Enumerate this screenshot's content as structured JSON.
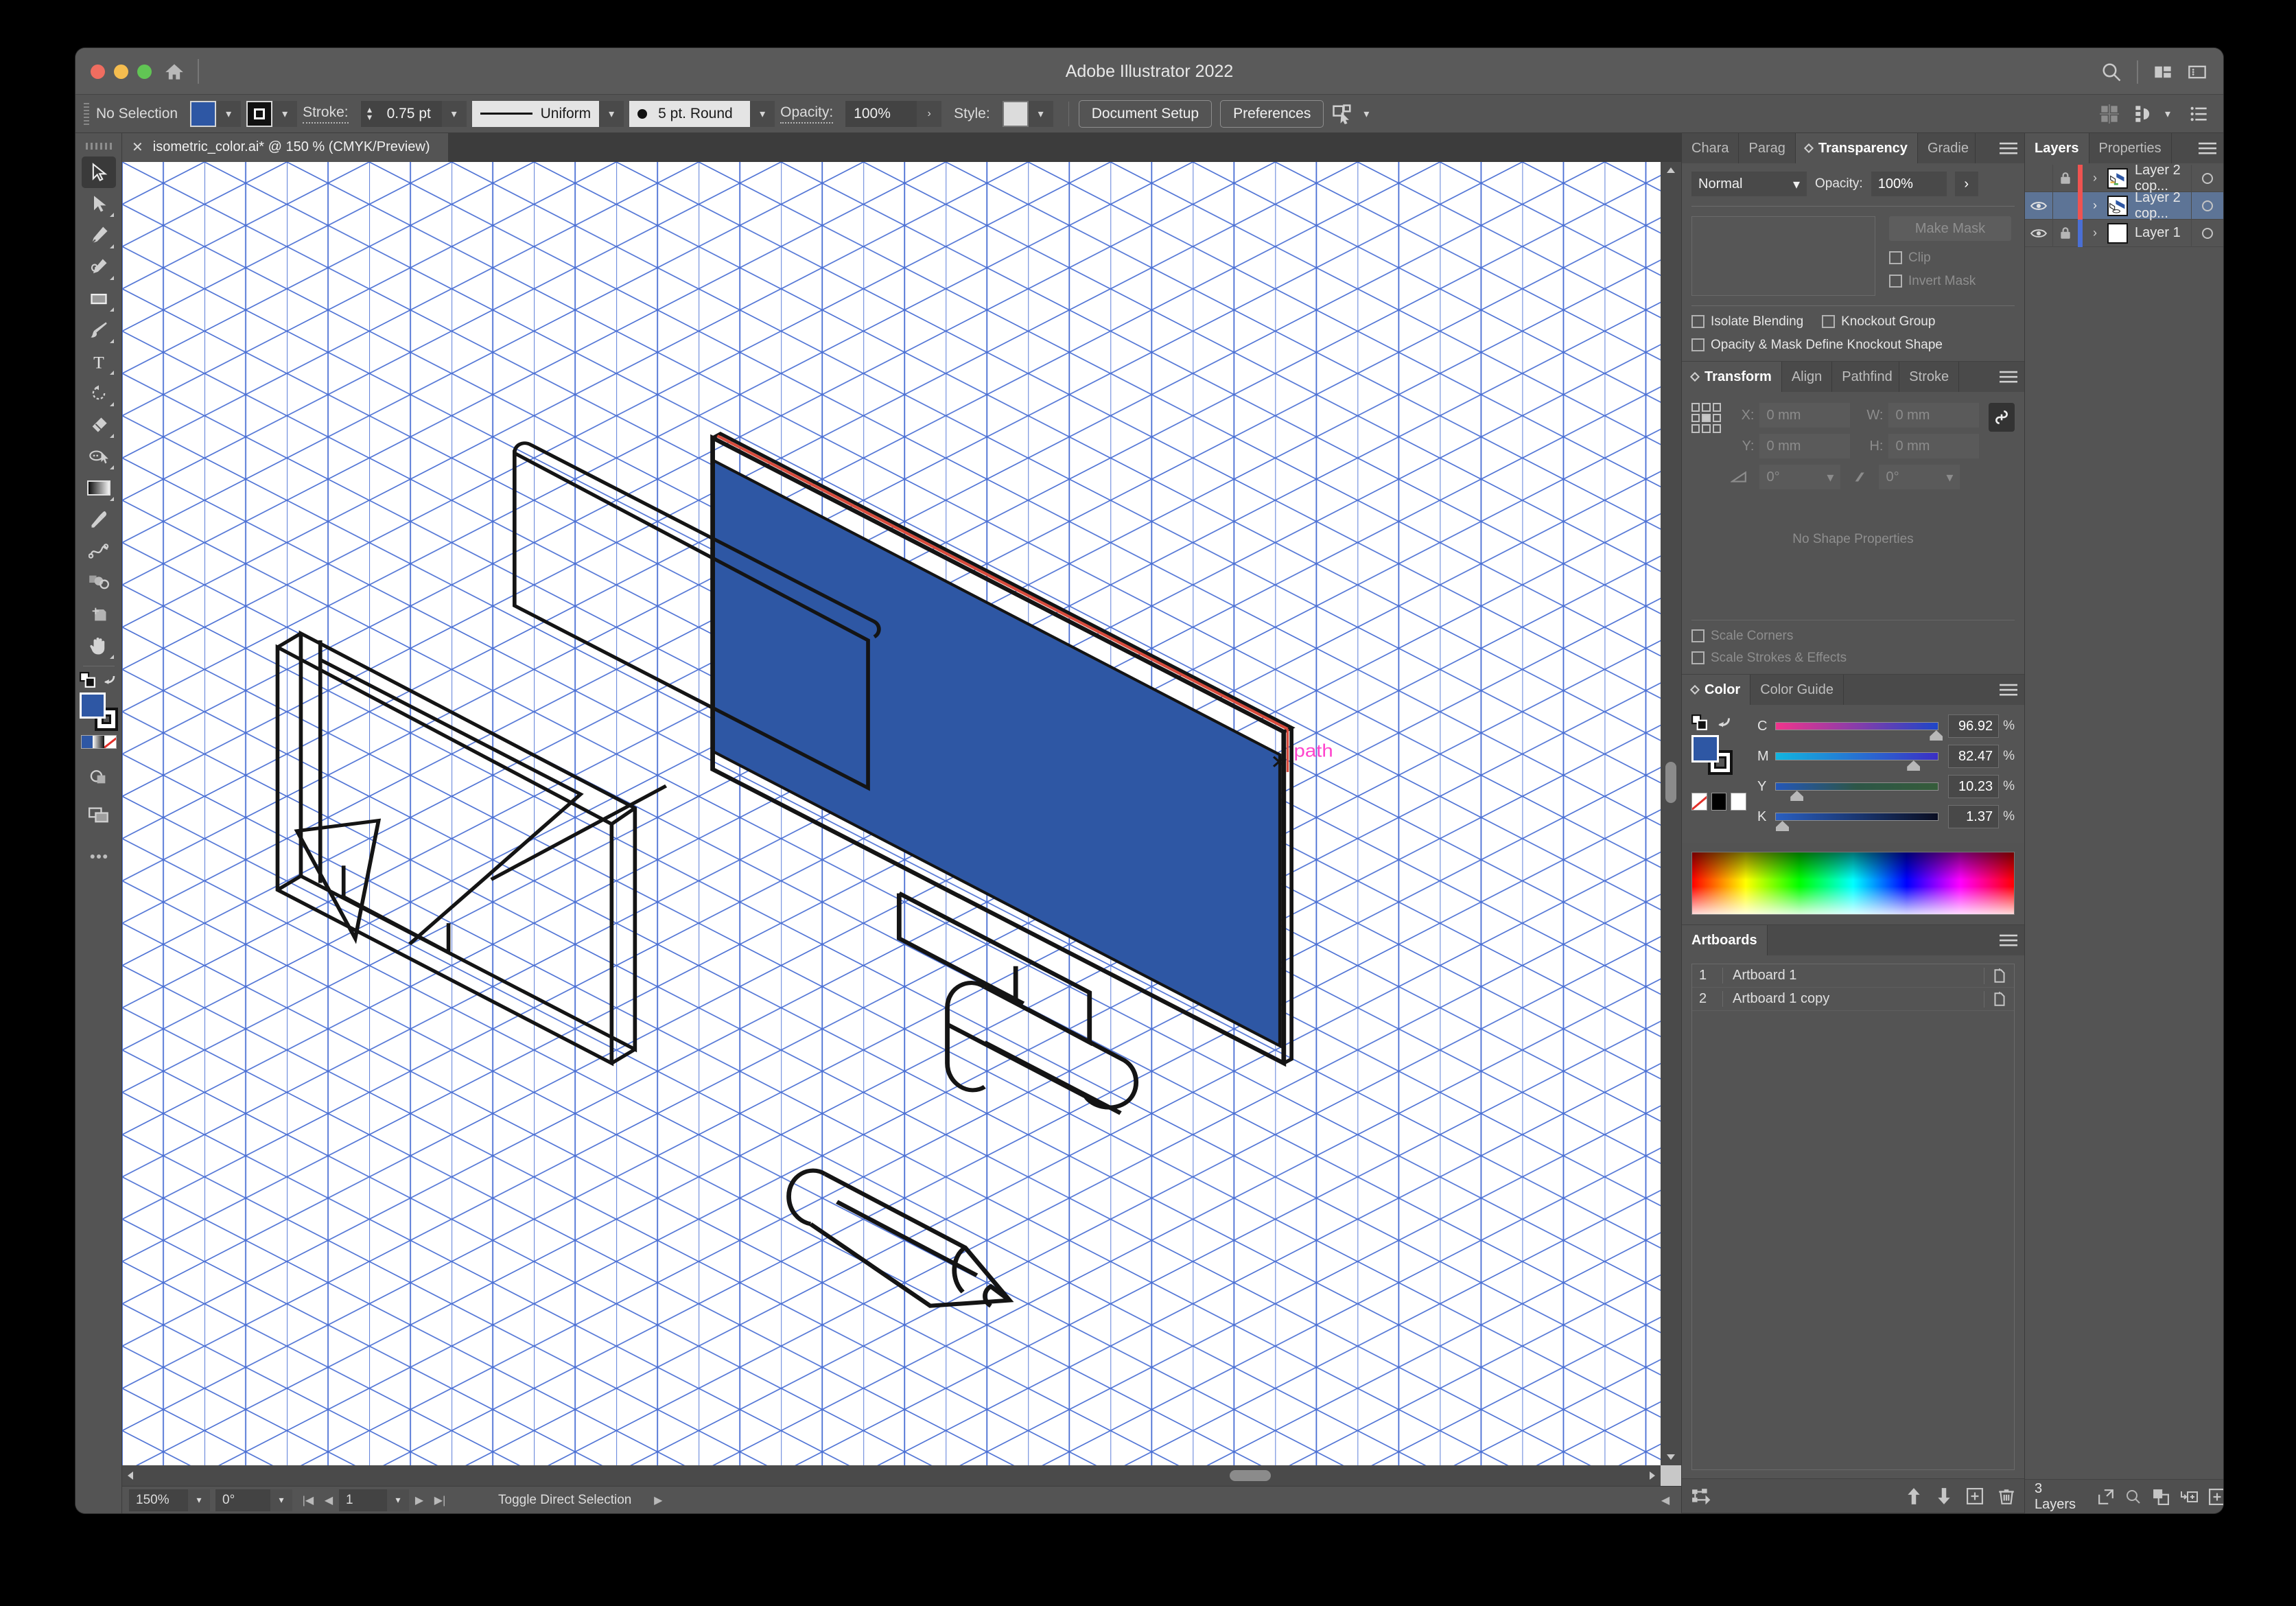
{
  "window": {
    "title": "Adobe Illustrator 2022",
    "traffic": [
      "close",
      "minimize",
      "zoom"
    ],
    "home_icon": "home-icon",
    "right_icons": [
      "search-icon",
      "workspace-switcher-icon",
      "panel-toggle-icon"
    ]
  },
  "control_bar": {
    "selection_status": "No Selection",
    "fill_swatch_color": "#2e57a4",
    "stroke_label": "Stroke:",
    "stroke_weight": "0.75 pt",
    "stroke_profile": "Uniform",
    "brush_definition": "5 pt. Round",
    "opacity_label": "Opacity:",
    "opacity_value": "100%",
    "style_label": "Style:",
    "document_setup_button": "Document Setup",
    "preferences_button": "Preferences",
    "select_similar_icon": "select-similar-icon",
    "align_icon": "align-icon",
    "distribute_icon": "distribute-icon",
    "more_options_icon": "more-options-icon"
  },
  "toolbar": {
    "tools": [
      {
        "name": "selection-tool",
        "glyph": "selection",
        "selected": true,
        "flyout": false
      },
      {
        "name": "direct-selection-tool",
        "glyph": "direct",
        "selected": false,
        "flyout": true
      },
      {
        "name": "pen-tool",
        "glyph": "pen",
        "selected": false,
        "flyout": true
      },
      {
        "name": "curvature-tool",
        "glyph": "curvature",
        "selected": false,
        "flyout": true
      },
      {
        "name": "rectangle-tool",
        "glyph": "rect",
        "selected": false,
        "flyout": true
      },
      {
        "name": "paintbrush-tool",
        "glyph": "brush",
        "selected": false,
        "flyout": true
      },
      {
        "name": "type-tool",
        "glyph": "type",
        "selected": false,
        "flyout": true
      },
      {
        "name": "rotate-tool",
        "glyph": "rotate",
        "selected": false,
        "flyout": true
      },
      {
        "name": "eraser-tool",
        "glyph": "eraser",
        "selected": false,
        "flyout": true
      },
      {
        "name": "shape-builder-tool",
        "glyph": "shapebuilder",
        "selected": false,
        "flyout": true
      },
      {
        "name": "gradient-tool",
        "glyph": "gradient",
        "selected": false,
        "flyout": true
      },
      {
        "name": "eyedropper-tool",
        "glyph": "eyedropper",
        "selected": false,
        "flyout": false
      },
      {
        "name": "blend-tool",
        "glyph": "blend",
        "selected": false,
        "flyout": false
      },
      {
        "name": "symbol-sprayer-tool",
        "glyph": "symbol",
        "selected": false,
        "flyout": false
      },
      {
        "name": "artboard-tool",
        "glyph": "artboard",
        "selected": false,
        "flyout": false
      },
      {
        "name": "hand-tool",
        "glyph": "hand",
        "selected": false,
        "flyout": true
      }
    ],
    "swap_fill_stroke_icon": "swap-fill-stroke-icon",
    "default_fill_stroke_icon": "default-fill-stroke-icon",
    "fill_color": "#2e57a4",
    "stroke_color": "#ffffff",
    "color_mode_icons": [
      "color-mode-icon",
      "gradient-mode-icon",
      "none-mode-icon"
    ],
    "drawing_mode_icon": "drawing-mode-icon",
    "screen_mode_icon": "screen-mode-icon",
    "edit_toolbar_icon": "edit-toolbar-icon"
  },
  "document_tab": {
    "close_icon": "close-icon",
    "label": "isometric_color.ai* @ 150 % (CMYK/Preview)"
  },
  "canvas": {
    "grid_color": "#4a6fd4",
    "artwork_fill": "#2e57a4",
    "smart_guide_label": "path",
    "smart_guide_color": "#ff44cc",
    "highlight_path_color": "#d94b3c"
  },
  "status_bar": {
    "zoom_level": "150%",
    "rotation": "0°",
    "artboard_number": "1",
    "status_text": "Toggle Direct Selection",
    "first_icon": "first-artboard-icon",
    "prev_icon": "previous-artboard-icon",
    "next_icon": "next-artboard-icon",
    "last_icon": "last-artboard-icon",
    "expand_icon": "expand-status-icon"
  },
  "transparency_panel": {
    "tabs": [
      {
        "label": "Chara",
        "active": false
      },
      {
        "label": "Parag",
        "active": false
      },
      {
        "label": "Transparency",
        "active": true
      },
      {
        "label": "Gradie",
        "active": false
      }
    ],
    "menu_icon": "panel-menu-icon",
    "blend_mode": "Normal",
    "opacity_label": "Opacity:",
    "opacity_value": "100%",
    "expand_icon": "expand-arrow-icon",
    "make_mask_button": "Make Mask",
    "clip_checkbox": "Clip",
    "invert_mask_checkbox": "Invert Mask",
    "isolate_blending_checkbox": "Isolate Blending",
    "knockout_group_checkbox": "Knockout Group",
    "opacity_mask_checkbox": "Opacity & Mask Define Knockout Shape"
  },
  "transform_panel": {
    "tabs": [
      {
        "label": "Transform",
        "active": true
      },
      {
        "label": "Align",
        "active": false
      },
      {
        "label": "Pathfind",
        "active": false
      },
      {
        "label": "Stroke",
        "active": false
      }
    ],
    "menu_icon": "panel-menu-icon",
    "x_label": "X:",
    "x_value": "0 mm",
    "y_label": "Y:",
    "y_value": "0 mm",
    "w_label": "W:",
    "w_value": "0 mm",
    "h_label": "H:",
    "h_value": "0 mm",
    "angle_value": "0°",
    "shear_value": "0°",
    "link_icon": "link-dimensions-icon",
    "reference_point_icon": "reference-point-icon",
    "no_shape_properties": "No Shape Properties",
    "scale_corners_checkbox": "Scale Corners",
    "scale_strokes_checkbox": "Scale Strokes & Effects"
  },
  "color_panel": {
    "tabs": [
      {
        "label": "Color",
        "active": true
      },
      {
        "label": "Color Guide",
        "active": false
      }
    ],
    "menu_icon": "panel-menu-icon",
    "fill_color": "#2e57a4",
    "swap_icon": "swap-fill-stroke-icon",
    "revert_icon": "revert-color-icon",
    "channels": [
      {
        "letter": "C",
        "value": "96.92",
        "unit": "%",
        "pos": 96.92
      },
      {
        "letter": "M",
        "value": "82.47",
        "unit": "%",
        "pos": 82.47
      },
      {
        "letter": "Y",
        "value": "10.23",
        "unit": "%",
        "pos": 10.23
      },
      {
        "letter": "K",
        "value": "1.37",
        "unit": "%",
        "pos": 1.37
      }
    ],
    "quick_swatches": [
      "none-swatch",
      "black-swatch",
      "white-swatch"
    ]
  },
  "artboards_panel": {
    "title": "Artboards",
    "menu_icon": "panel-menu-icon",
    "rows": [
      {
        "num": "1",
        "name": "Artboard 1"
      },
      {
        "num": "2",
        "name": "Artboard 1 copy"
      }
    ],
    "footer_icons": [
      "rearrange-artboards-icon",
      "move-up-icon",
      "move-down-icon",
      "new-artboard-icon",
      "delete-artboard-icon"
    ]
  },
  "layers_panel": {
    "tabs": [
      {
        "label": "Layers",
        "active": true
      },
      {
        "label": "Properties",
        "active": false
      }
    ],
    "menu_icon": "panel-menu-icon",
    "rows": [
      {
        "name": "Layer 2 cop...",
        "visible": false,
        "locked": true,
        "color": "#ef5350",
        "selected": false,
        "target_icon": "target-circle-icon"
      },
      {
        "name": "Layer 2 cop...",
        "visible": true,
        "locked": false,
        "color": "#ef5350",
        "selected": true,
        "target_icon": "target-circle-icon"
      },
      {
        "name": "Layer 1",
        "visible": true,
        "locked": true,
        "color": "#4a6fd4",
        "selected": false,
        "target_icon": "target-circle-icon"
      }
    ],
    "footer_count": "3 Layers",
    "footer_icons": [
      "release-to-layers-icon",
      "locate-object-icon",
      "make-clipping-mask-icon",
      "create-sublayer-icon",
      "new-layer-icon",
      "delete-layer-icon"
    ]
  }
}
